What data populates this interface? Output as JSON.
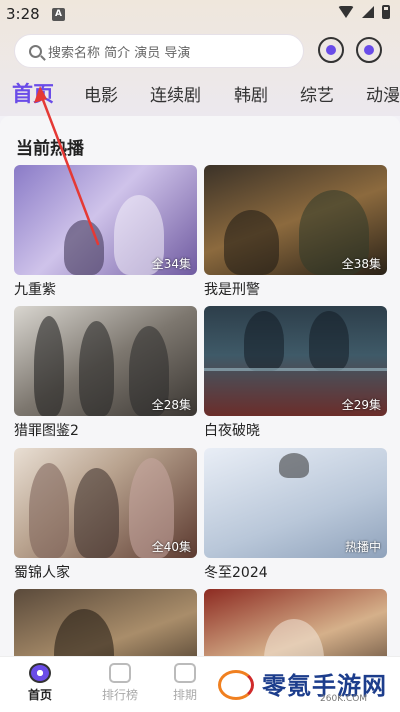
{
  "status_bar": {
    "time": "3:28",
    "notification": "A"
  },
  "search": {
    "placeholder": "搜索名称 简介 演员 导演"
  },
  "tabs": [
    {
      "label": "首页"
    },
    {
      "label": "电影"
    },
    {
      "label": "连续剧"
    },
    {
      "label": "韩剧"
    },
    {
      "label": "综艺"
    },
    {
      "label": "动漫"
    }
  ],
  "section": {
    "title": "当前热播"
  },
  "cards": [
    {
      "title": "九重紫",
      "badge": "全34集"
    },
    {
      "title": "我是刑警",
      "badge": "全38集"
    },
    {
      "title": "猎罪图鉴2",
      "badge": "全28集"
    },
    {
      "title": "白夜破晓",
      "badge": "全29集"
    },
    {
      "title": "蜀锦人家",
      "badge": "全40集"
    },
    {
      "title": "冬至2024",
      "badge": "热播中"
    },
    {
      "title": "",
      "badge": ""
    },
    {
      "title": "",
      "badge": ""
    }
  ],
  "bottom_nav": [
    {
      "label": "首页"
    },
    {
      "label": "排行榜"
    },
    {
      "label": "排期"
    }
  ],
  "watermark": {
    "text": "零氪手游网",
    "sub": "260K.COM"
  },
  "colors": {
    "accent": "#6a4ce8",
    "annotation_arrow": "#e53935"
  }
}
